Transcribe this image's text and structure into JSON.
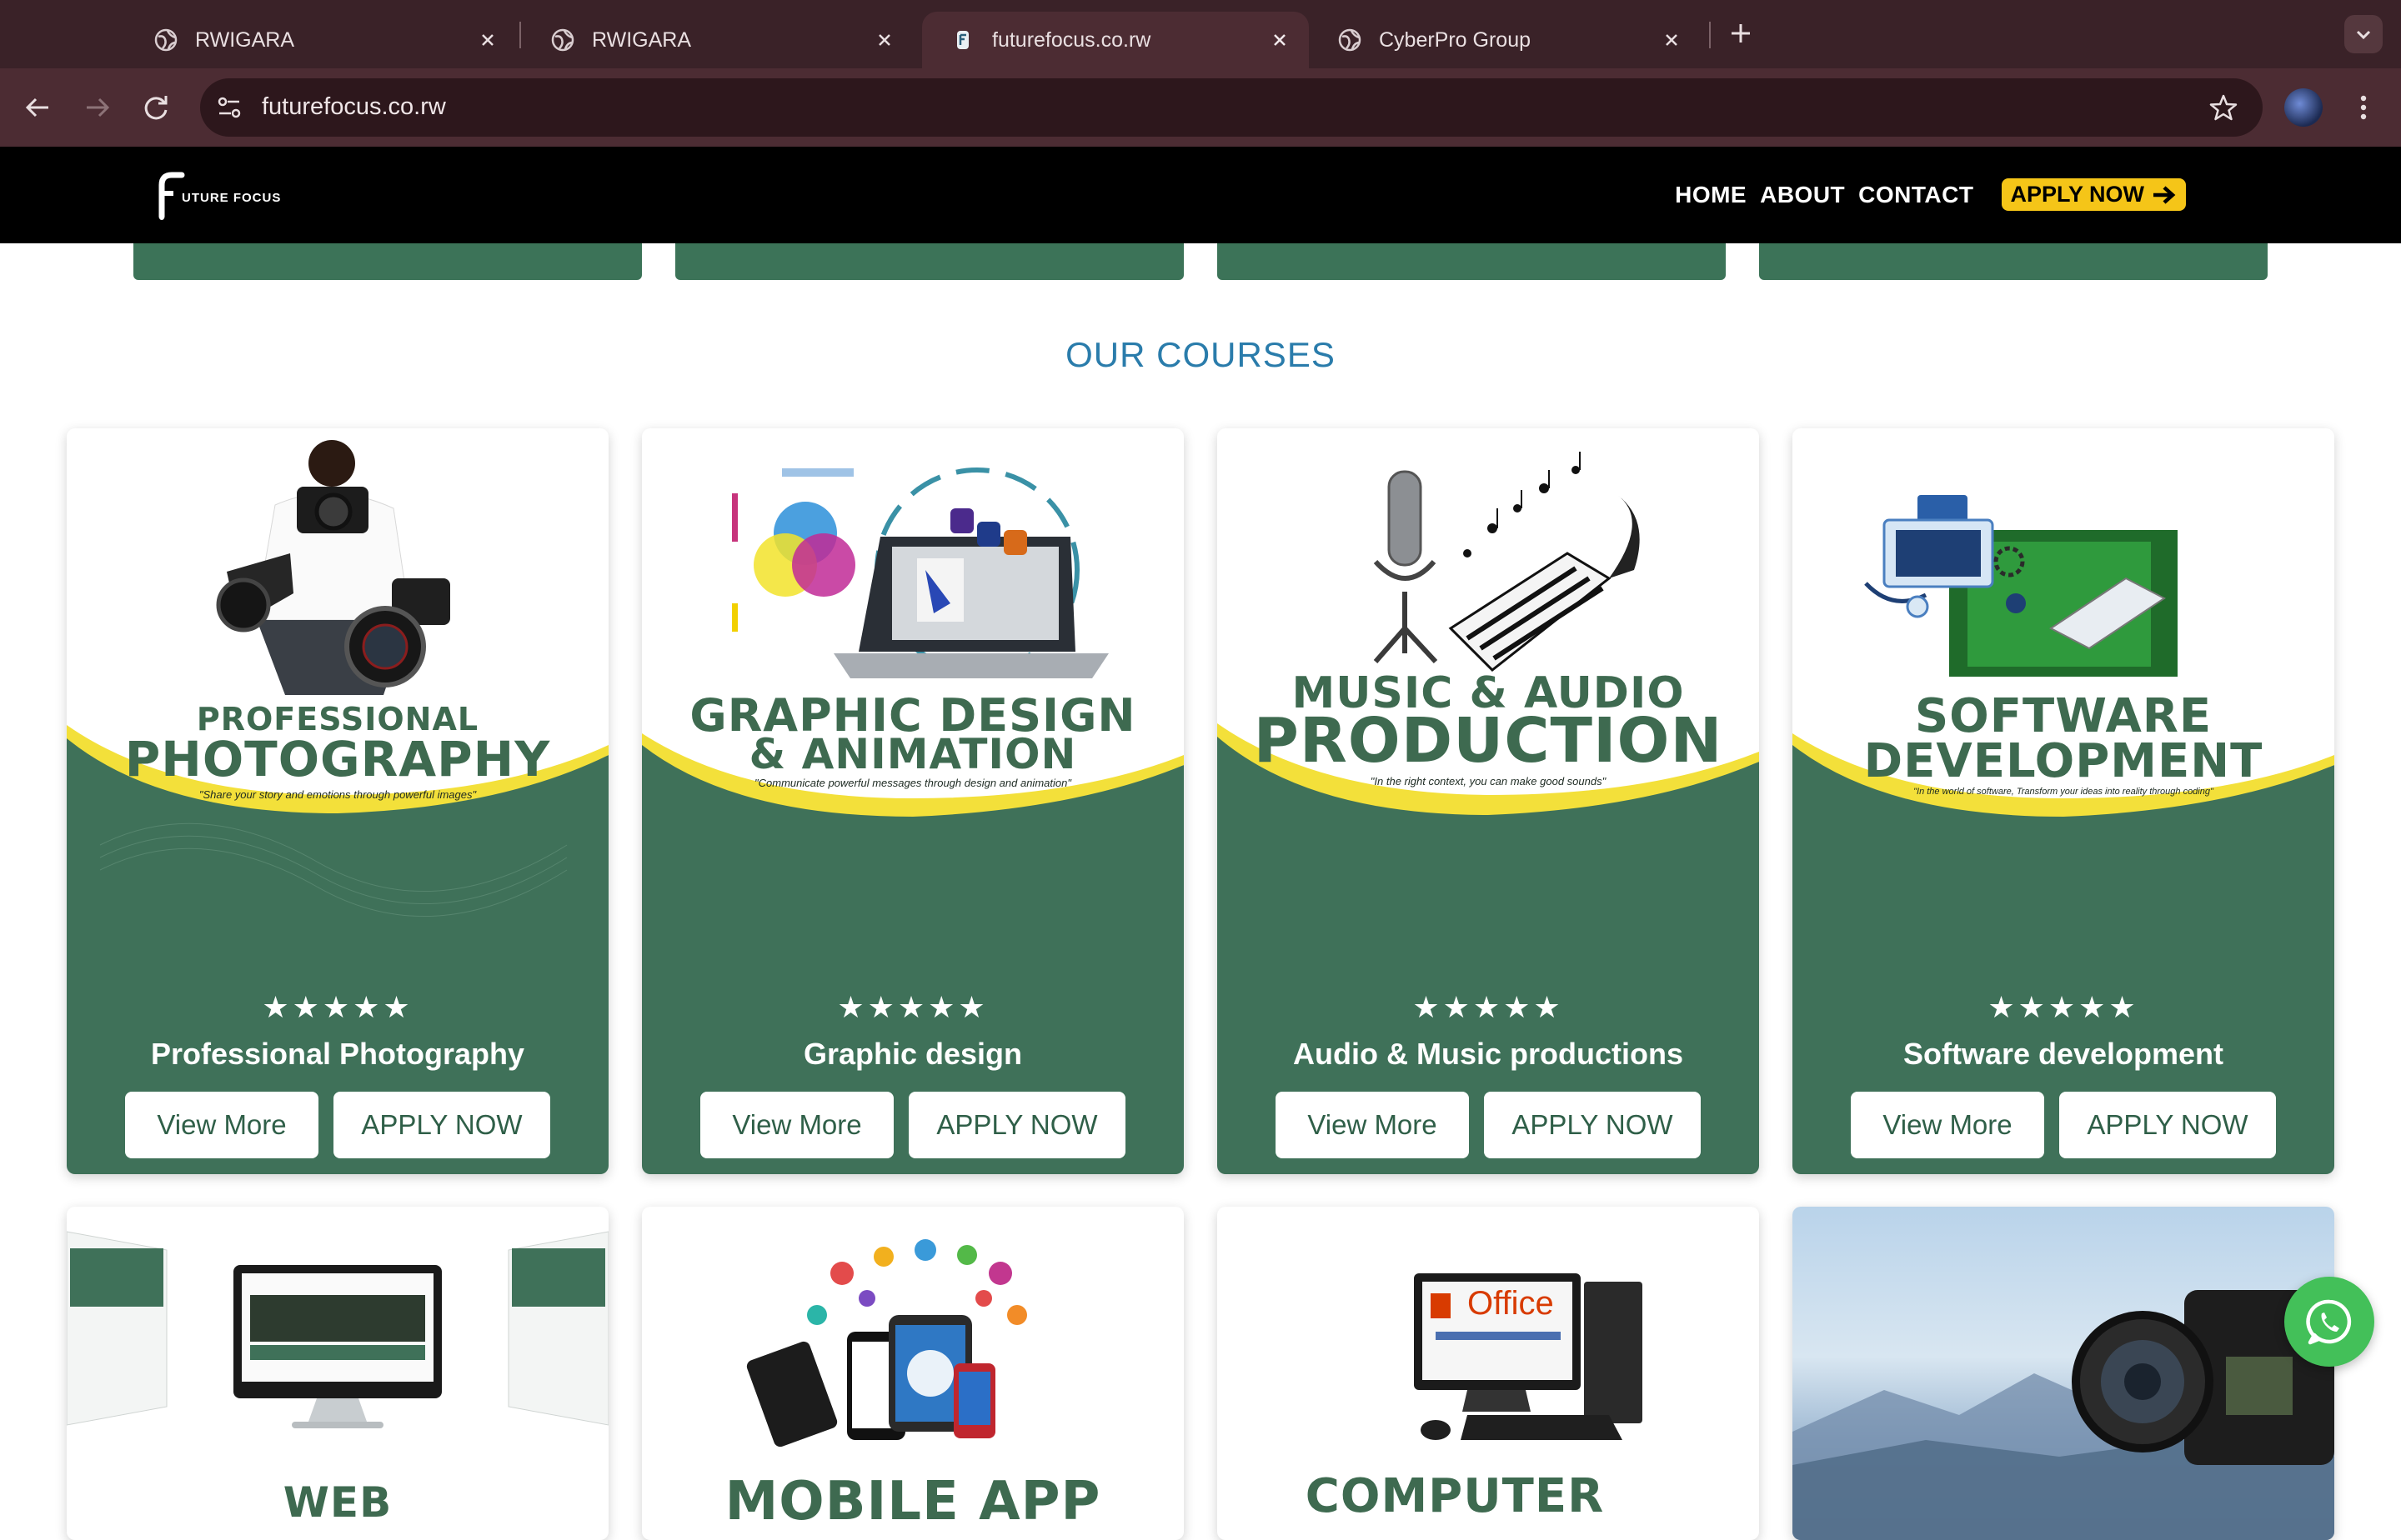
{
  "browser": {
    "tabs": [
      {
        "title": "RWIGARA",
        "active": false
      },
      {
        "title": "RWIGARA",
        "active": false
      },
      {
        "title": "futurefocus.co.rw",
        "active": true
      },
      {
        "title": "CyberPro Group",
        "active": false
      }
    ],
    "url": "futurefocus.co.rw"
  },
  "site": {
    "logo_text": "UTURE FOCUS",
    "nav": {
      "home": "HOME",
      "about": "ABOUT",
      "contact": "CONTACT",
      "apply": "APPLY NOW"
    },
    "section_title": "OUR COURSES",
    "courses": [
      {
        "poster_line1": "PROFESSIONAL",
        "poster_line2": "PHOTOGRAPHY",
        "tagline": "\"Share your story and emotions through powerful images\"",
        "name": "Professional Photography",
        "stars": "★★★★★",
        "view": "View More",
        "apply": "APPLY NOW"
      },
      {
        "poster_line1": "GRAPHIC DESIGN",
        "poster_line2": "& ANIMATION",
        "tagline": "\"Communicate powerful messages through design and animation\"",
        "name": "Graphic design",
        "stars": "★★★★★",
        "view": "View More",
        "apply": "APPLY NOW"
      },
      {
        "poster_line1": "MUSIC & AUDIO",
        "poster_line2": "PRODUCTION",
        "tagline": "\"In the right context, you can make good sounds\"",
        "name": "Audio & Music productions",
        "stars": "★★★★★",
        "view": "View More",
        "apply": "APPLY NOW"
      },
      {
        "poster_line1": "SOFTWARE",
        "poster_line2": "DEVELOPMENT",
        "tagline": "\"In the world of software, Transform your ideas into reality through coding\"",
        "name": "Software development",
        "stars": "★★★★★",
        "view": "View More",
        "apply": "APPLY NOW"
      }
    ],
    "next_row": [
      {
        "poster_line1": "WEB"
      },
      {
        "poster_line1": "MOBILE APP"
      },
      {
        "poster_line1": "COMPUTER",
        "screen_text": "Office"
      },
      {
        "poster_line1": ""
      }
    ]
  },
  "colors": {
    "brand_green": "#3f7159",
    "accent_yellow": "#f5c518",
    "title_blue": "#2a7cab"
  },
  "icons": [
    "globe-icon",
    "close-icon",
    "new-tab-icon",
    "tab-search-icon",
    "back-icon",
    "forward-icon",
    "reload-icon",
    "site-info-icon",
    "star-icon",
    "profile-avatar",
    "kebab-menu-icon",
    "arrow-right-icon",
    "whatsapp-icon"
  ]
}
